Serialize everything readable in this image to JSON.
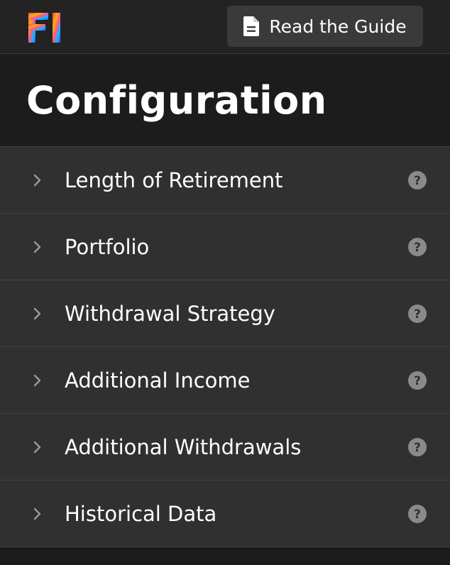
{
  "logo": {
    "text": "FI"
  },
  "topbar": {
    "guide_button_label": "Read the Guide",
    "guide_icon": "document-icon"
  },
  "header": {
    "title": "Configuration"
  },
  "sections": [
    {
      "label": "Length of Retirement",
      "icon": "chevron-right-icon",
      "help_icon": "help-circle-icon"
    },
    {
      "label": "Portfolio",
      "icon": "chevron-right-icon",
      "help_icon": "help-circle-icon"
    },
    {
      "label": "Withdrawal Strategy",
      "icon": "chevron-right-icon",
      "help_icon": "help-circle-icon"
    },
    {
      "label": "Additional Income",
      "icon": "chevron-right-icon",
      "help_icon": "help-circle-icon"
    },
    {
      "label": "Additional Withdrawals",
      "icon": "chevron-right-icon",
      "help_icon": "help-circle-icon"
    },
    {
      "label": "Historical Data",
      "icon": "chevron-right-icon",
      "help_icon": "help-circle-icon"
    }
  ],
  "colors": {
    "background": "#1f1f1f",
    "row_background": "#303030",
    "button_background": "#3a3a3a",
    "text": "#ffffff",
    "muted_icon": "#8a8a8a",
    "logo_gradient": [
      "#ff3d6e",
      "#ffb000",
      "#00c2ff",
      "#5b3cff"
    ]
  }
}
